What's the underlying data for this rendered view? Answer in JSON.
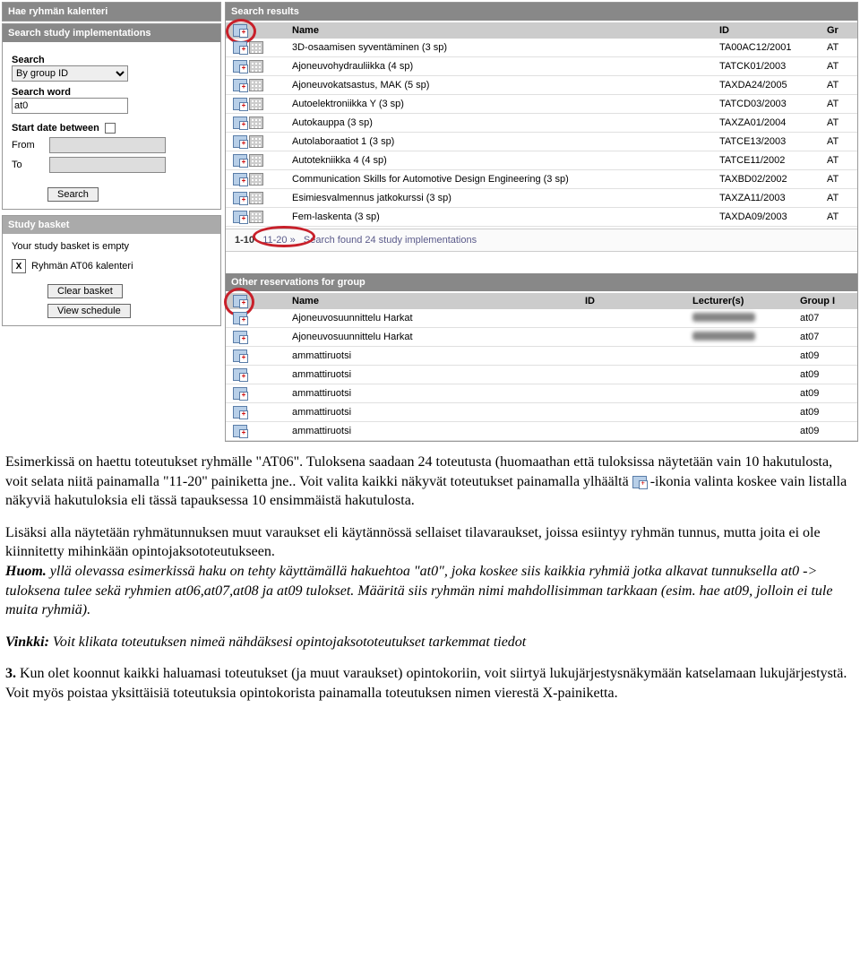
{
  "sidebar": {
    "nav1": "Hae ryhmän kalenteri",
    "nav2": "Search study implementations",
    "search_label": "Search",
    "search_select": "By group ID",
    "word_label": "Search word",
    "word_value": "at0",
    "date_label": "Start date between",
    "from_label": "From",
    "to_label": "To",
    "search_btn": "Search"
  },
  "basket": {
    "title": "Study basket",
    "empty_text": "Your study basket is empty",
    "item": "Ryhmän AT06 kalenteri",
    "clear_btn": "Clear basket",
    "view_btn": "View schedule"
  },
  "results": {
    "title": "Search results",
    "col_name": "Name",
    "col_id": "ID",
    "col_gr": "Gr",
    "rows": [
      {
        "name": "3D-osaamisen syventäminen (3 sp)",
        "id": "TA00AC12/2001",
        "gr": "AT"
      },
      {
        "name": "Ajoneuvohydrauliikka (4 sp)",
        "id": "TATCK01/2003",
        "gr": "AT"
      },
      {
        "name": "Ajoneuvokatsastus, MAK (5 sp)",
        "id": "TAXDA24/2005",
        "gr": "AT"
      },
      {
        "name": "Autoelektroniikka Y (3 sp)",
        "id": "TATCD03/2003",
        "gr": "AT"
      },
      {
        "name": "Autokauppa (3 sp)",
        "id": "TAXZA01/2004",
        "gr": "AT"
      },
      {
        "name": "Autolaboraatiot 1 (3 sp)",
        "id": "TATCE13/2003",
        "gr": "AT"
      },
      {
        "name": "Autotekniikka 4 (4 sp)",
        "id": "TATCE11/2002",
        "gr": "AT"
      },
      {
        "name": "Communication Skills for Automotive Design Engineering (3 sp)",
        "id": "TAXBD02/2002",
        "gr": "AT"
      },
      {
        "name": "Esimiesvalmennus jatkokurssi (3 sp)",
        "id": "TAXZA11/2003",
        "gr": "AT"
      },
      {
        "name": "Fem-laskenta (3 sp)",
        "id": "TAXDA09/2003",
        "gr": "AT"
      }
    ],
    "pager_current": "1-10",
    "pager_next": "11-20",
    "pager_arrow": "»",
    "pager_text": "Search found 24 study implementations"
  },
  "other": {
    "title": "Other reservations for group",
    "col_name": "Name",
    "col_id": "ID",
    "col_lect": "Lecturer(s)",
    "col_grp": "Group I",
    "rows": [
      {
        "name": "Ajoneuvosuunnittelu Harkat",
        "grp": "at07"
      },
      {
        "name": "Ajoneuvosuunnittelu Harkat",
        "grp": "at07"
      },
      {
        "name": "ammattiruotsi",
        "grp": "at09"
      },
      {
        "name": "ammattiruotsi",
        "grp": "at09"
      },
      {
        "name": "ammattiruotsi",
        "grp": "at09"
      },
      {
        "name": "ammattiruotsi",
        "grp": "at09"
      },
      {
        "name": "ammattiruotsi",
        "grp": "at09"
      }
    ]
  },
  "doc": {
    "p1a": "Esimerkissä on haettu toteutukset ryhmälle \"AT06\". Tuloksena saadaan 24 toteutusta (huomaathan että tuloksissa näytetään vain 10 hakutulosta, voit selata niitä painamalla \"11-20\" painiketta jne.. Voit valita kaikki näkyvät toteutukset painamalla ylhäältä ",
    "p1b": " -ikonia valinta koskee vain listalla näkyviä hakutuloksia eli tässä tapauksessa 10 ensimmäistä hakutulosta.",
    "p2": "Lisäksi alla näytetään ryhmätunnuksen muut varaukset eli käytännössä sellaiset tilavaraukset, joissa esiintyy ryhmän tunnus, mutta joita ei ole kiinnitetty mihinkään opintojaksototeutukseen.",
    "p3a": "Huom.",
    "p3b": " yllä olevassa esimerkissä haku on tehty käyttämällä hakuehtoa \"at0\", joka koskee siis kaikkia ryhmiä jotka alkavat tunnuksella at0 -> tuloksena tulee sekä ryhmien at06,at07,at08 ja at09 tulokset. Määritä siis ryhmän nimi mahdollisimman tarkkaan (esim. hae at09, jolloin ei tule muita ryhmiä).",
    "p4a": "Vinkki:",
    "p4b": " Voit klikata toteutuksen nimeä nähdäksesi opintojaksototeutukset tarkemmat tiedot",
    "p5a": "3.",
    "p5b": " Kun olet koonnut kaikki haluamasi toteutukset (ja muut varaukset) opintokoriin, voit siirtyä lukujärjestysnäkymään katselamaan lukujärjestystä. Voit myös poistaa yksittäisiä toteutuksia opintokorista painamalla toteutuksen nimen vierestä X-painiketta."
  }
}
